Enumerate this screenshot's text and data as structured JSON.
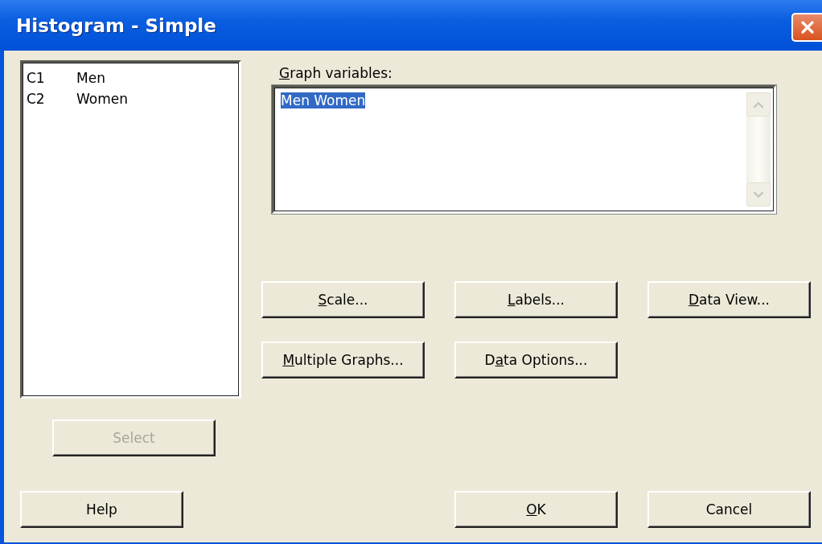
{
  "window": {
    "title": "Histogram - Simple"
  },
  "variables_list": [
    {
      "column": "C1",
      "name": "Men"
    },
    {
      "column": "C2",
      "name": "Women"
    }
  ],
  "select_button": {
    "label": {
      "text": "Select"
    },
    "disabled": true
  },
  "graph_variables": {
    "label": {
      "access_key": "G",
      "text": "raph variables:"
    },
    "value": "Men Women",
    "value_selected": true
  },
  "option_buttons": [
    {
      "label": {
        "access_key": "S",
        "text": "cale..."
      },
      "disabled": false
    },
    {
      "label": {
        "access_key": "L",
        "text": "abels..."
      },
      "disabled": false
    },
    {
      "label": {
        "access_key": "D",
        "text": "ata View..."
      },
      "disabled": false
    },
    {
      "label": {
        "access_key": "M",
        "text": "ultiple Graphs..."
      },
      "disabled": false
    },
    {
      "label": {
        "lead": "D",
        "access_key": "a",
        "text": "ta Options..."
      },
      "disabled": false
    }
  ],
  "bottom_buttons": [
    {
      "label": {
        "text": "Help"
      },
      "disabled": false
    },
    {
      "label": {
        "access_key": "O",
        "text": "K"
      },
      "disabled": false
    },
    {
      "label": {
        "text": "Cancel"
      },
      "disabled": false
    }
  ]
}
